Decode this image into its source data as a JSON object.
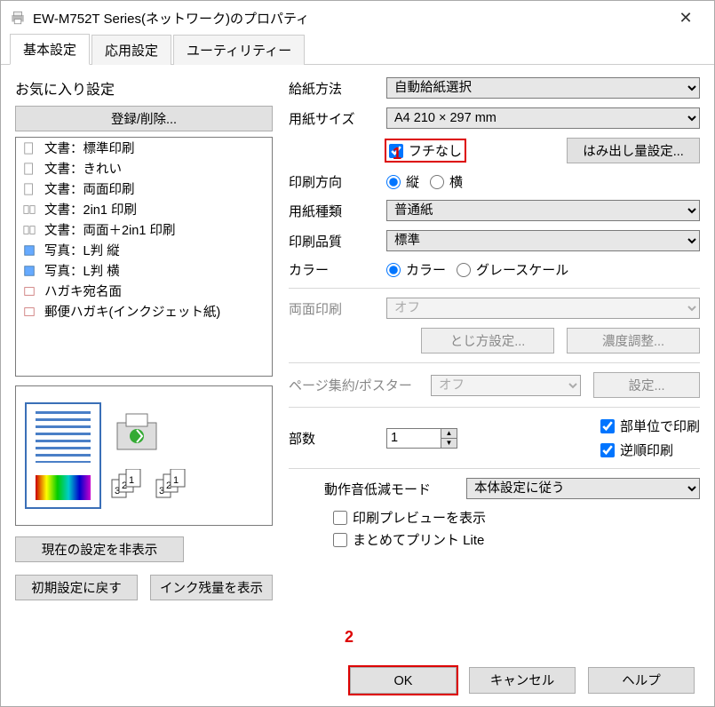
{
  "window": {
    "title": "EW-M752T Series(ネットワーク)のプロパティ"
  },
  "tabs": {
    "basic": "基本設定",
    "advanced": "応用設定",
    "utility": "ユーティリティー"
  },
  "presets": {
    "title": "お気に入り設定",
    "register": "登録/削除...",
    "items": [
      "文書：標準印刷",
      "文書：きれい",
      "文書：両面印刷",
      "文書：2in1 印刷",
      "文書：両面＋2in1 印刷",
      "写真：L判 縦",
      "写真：L判 横",
      "ハガキ宛名面",
      "郵便ハガキ(インクジェット紙)"
    ],
    "hide_current": "現在の設定を非表示",
    "restore_defaults": "初期設定に戻す",
    "ink_levels": "インク残量を表示"
  },
  "settings": {
    "paper_source_lbl": "給紙方法",
    "paper_source": "自動給紙選択",
    "paper_size_lbl": "用紙サイズ",
    "paper_size": "A4 210 × 297 mm",
    "borderless_lbl": "フチなし",
    "bleed_btn": "はみ出し量設定...",
    "orientation_lbl": "印刷方向",
    "orient_portrait": "縦",
    "orient_landscape": "横",
    "media_type_lbl": "用紙種類",
    "media_type": "普通紙",
    "quality_lbl": "印刷品質",
    "quality": "標準",
    "color_lbl": "カラー",
    "color_color": "カラー",
    "color_gray": "グレースケール",
    "duplex_lbl": "両面印刷",
    "duplex_val": "オフ",
    "binding_btn": "とじ方設定...",
    "density_btn": "濃度調整...",
    "nup_lbl": "ページ集約/ポスター",
    "nup_val": "オフ",
    "nup_settings_btn": "設定...",
    "copies_lbl": "部数",
    "copies_val": "1",
    "collate_lbl": "部単位で印刷",
    "reverse_lbl": "逆順印刷",
    "quiet_lbl": "動作音低減モード",
    "quiet_val": "本体設定に従う",
    "preview_lbl": "印刷プレビューを表示",
    "batch_lbl": "まとめてプリント Lite"
  },
  "footer": {
    "ok": "OK",
    "cancel": "キャンセル",
    "help": "ヘルプ"
  },
  "markers": {
    "one": "1",
    "two": "2"
  }
}
